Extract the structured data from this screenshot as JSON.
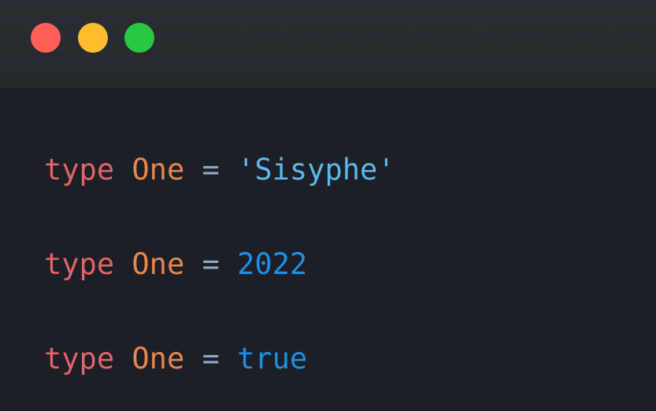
{
  "window": {
    "controls": {
      "close_color": "#ff5f57",
      "minimize_color": "#febc2e",
      "maximize_color": "#28c840",
      "close_icon": "close-dot",
      "minimize_icon": "minimize-dot",
      "maximize_icon": "maximize-dot"
    }
  },
  "code": {
    "lines": [
      {
        "keyword": "type",
        "name": "One",
        "operator": "=",
        "value": "'Sisyphe'",
        "value_kind": "string"
      },
      {
        "keyword": "type",
        "name": "One",
        "operator": "=",
        "value": "2022",
        "value_kind": "number"
      },
      {
        "keyword": "type",
        "name": "One",
        "operator": "=",
        "value": "true",
        "value_kind": "boolean"
      }
    ]
  },
  "colors": {
    "keyword": "#e06468",
    "type_name": "#e5874f",
    "operator": "#8fa6c6",
    "string": "#5cb8ee",
    "number": "#1f8fe3",
    "boolean": "#1f8fe3",
    "editor_background": "#1c1f25",
    "titlebar_background": "#282b30"
  }
}
